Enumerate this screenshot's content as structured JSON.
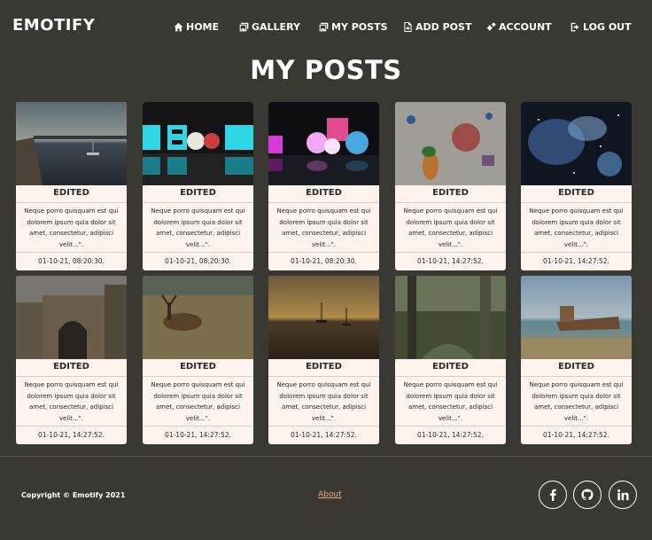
{
  "brand": "EMOTIFY",
  "nav": [
    {
      "label": "HOME",
      "icon": "home-icon"
    },
    {
      "label": "GALLERY",
      "icon": "gallery-icon"
    },
    {
      "label": "MY POSTS",
      "icon": "my-posts-icon"
    },
    {
      "label": "ADD POST",
      "icon": "add-post-icon"
    },
    {
      "label": "ACCOUNT",
      "icon": "gears-icon"
    },
    {
      "label": "LOG OUT",
      "icon": "logout-icon"
    }
  ],
  "page_title": "MY POSTS",
  "posts": [
    {
      "title": "EDITED",
      "body": "Neque porro quisquam est qui dolorem ipsum quia dolor sit amet, consectetur, adipisci velit...\".",
      "date": "01-10-21, 08:20:30.",
      "image": "harbor-pier-photo"
    },
    {
      "title": "EDITED",
      "body": "Neque porro quisquam est qui dolorem ipsum quia dolor sit amet, consectetur, adipisci velit...\".",
      "date": "01-10-21, 08:20:30.",
      "image": "neon-text-photo"
    },
    {
      "title": "EDITED",
      "body": "Neque porro quisquam est qui dolorem ipsum quia dolor sit amet, consectetur, adipisci velit...\".",
      "date": "01-10-21, 08:20:30.",
      "image": "glowing-shapes-photo"
    },
    {
      "title": "EDITED",
      "body": "Neque porro quisquam est qui dolorem ipsum quia dolor sit amet, consectetur, adipisci velit...\".",
      "date": "01-10-21, 14:27:52.",
      "image": "child-painting-photo"
    },
    {
      "title": "EDITED",
      "body": "Neque porro quisquam est qui dolorem ipsum quia dolor sit amet, consectetur, adipisci velit...\".",
      "date": "01-10-21, 14:27:52.",
      "image": "space-art-photo"
    },
    {
      "title": "EDITED",
      "body": "Neque porro quisquam est qui dolorem ipsum quia dolor sit amet, consectetur, adipisci velit...\".",
      "date": "01-10-21, 14:27:52.",
      "image": "stone-arch-photo"
    },
    {
      "title": "EDITED",
      "body": "Neque porro quisquam est qui dolorem ipsum quia dolor sit amet, consectetur, adipisci velit...\".",
      "date": "01-10-21, 14:27:52.",
      "image": "deer-field-photo"
    },
    {
      "title": "EDITED",
      "body": "Neque porro quisquam est qui dolorem ipsum quia dolor sit amet, consectetur, adipisci velit...\".",
      "date": "01-10-21, 14:27:52.",
      "image": "sunset-boats-photo"
    },
    {
      "title": "EDITED",
      "body": "Neque porro quisquam est qui dolorem ipsum quia dolor sit amet, consectetur, adipisci velit...\".",
      "date": "01-10-21, 14:27:52.",
      "image": "forest-stream-photo"
    },
    {
      "title": "EDITED",
      "body": "Neque porro quisquam est qui dolorem ipsum quia dolor sit amet, consectetur, adipisci velit...\".",
      "date": "01-10-21, 14:27:52.",
      "image": "shipwreck-shore-photo"
    }
  ],
  "footer": {
    "copyright": "Copyright © Emotify 2021",
    "about": "About",
    "social": [
      "facebook-icon",
      "github-icon",
      "linkedin-icon"
    ]
  },
  "colors": {
    "background": "#393832",
    "card": "#fff3ee",
    "link": "#e9a88a"
  }
}
